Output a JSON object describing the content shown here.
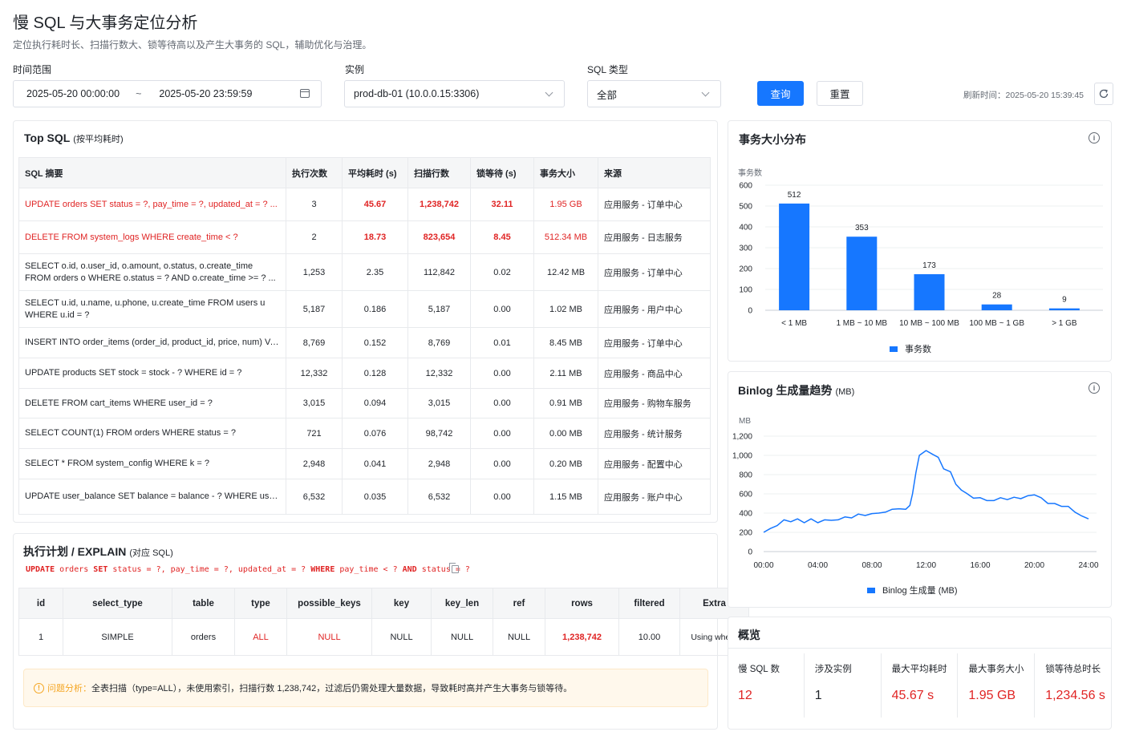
{
  "page": {
    "title": "慢 SQL 与大事务定位分析",
    "subtitle": "定位执行耗时长、扫描行数大、锁等待高以及产生大事务的 SQL，辅助优化与治理。"
  },
  "filters": {
    "time_label": "时间范围",
    "start": "2025-05-20 00:00:00",
    "sep": "~",
    "end": "2025-05-20 23:59:59",
    "instance_label": "实例",
    "instance_value": "prod-db-01 (10.0.0.15:3306)",
    "sqltype_label": "SQL 类型",
    "sqltype_value": "全部",
    "query_btn": "查询",
    "reset_btn": "重置",
    "refresh_text": "刷新时间：2025-05-20 15:39:45"
  },
  "top_sql": {
    "title": "Top SQL",
    "title_note": "(按平均耗时)",
    "columns": [
      "SQL 摘要",
      "执行次数",
      "平均耗时 (s)",
      "扫描行数",
      "锁等待 (s)",
      "事务大小",
      "来源"
    ],
    "rows": [
      {
        "sql": "UPDATE orders SET status = ?, pay_time = ?, updated_at = ? ...",
        "exec": "3",
        "avg": "45.67",
        "scan": "1,238,742",
        "lock": "32.11",
        "size": "1.95 GB",
        "src": "应用服务 - 订单中心",
        "hl": true
      },
      {
        "sql": "DELETE FROM system_logs WHERE create_time < ?",
        "exec": "2",
        "avg": "18.73",
        "scan": "823,654",
        "lock": "8.45",
        "size": "512.34 MB",
        "src": "应用服务 - 日志服务",
        "hl": true
      },
      {
        "sql": "SELECT o.id, o.user_id, o.amount, o.status, o.create_time FROM orders o WHERE o.status = ? AND o.create_time >= ? ...",
        "exec": "1,253",
        "avg": "2.35",
        "scan": "112,842",
        "lock": "0.02",
        "size": "12.42 MB",
        "src": "应用服务 - 订单中心",
        "hl": false
      },
      {
        "sql": "SELECT u.id, u.name, u.phone, u.create_time FROM users u WHERE u.id = ?",
        "exec": "5,187",
        "avg": "0.186",
        "scan": "5,187",
        "lock": "0.00",
        "size": "1.02 MB",
        "src": "应用服务 - 用户中心",
        "hl": false
      },
      {
        "sql": "INSERT INTO order_items (order_id, product_id, price, num) VALUES ...",
        "exec": "8,769",
        "avg": "0.152",
        "scan": "8,769",
        "lock": "0.01",
        "size": "8.45 MB",
        "src": "应用服务 - 订单中心",
        "hl": false
      },
      {
        "sql": "UPDATE products SET stock = stock - ? WHERE id = ?",
        "exec": "12,332",
        "avg": "0.128",
        "scan": "12,332",
        "lock": "0.00",
        "size": "2.11 MB",
        "src": "应用服务 - 商品中心",
        "hl": false
      },
      {
        "sql": "DELETE FROM cart_items WHERE user_id = ?",
        "exec": "3,015",
        "avg": "0.094",
        "scan": "3,015",
        "lock": "0.00",
        "size": "0.91 MB",
        "src": "应用服务 - 购物车服务",
        "hl": false
      },
      {
        "sql": "SELECT COUNT(1) FROM orders WHERE status = ?",
        "exec": "721",
        "avg": "0.076",
        "scan": "98,742",
        "lock": "0.00",
        "size": "0.00 MB",
        "src": "应用服务 - 统计服务",
        "hl": false
      },
      {
        "sql": "SELECT * FROM system_config WHERE k = ?",
        "exec": "2,948",
        "avg": "0.041",
        "scan": "2,948",
        "lock": "0.00",
        "size": "0.20 MB",
        "src": "应用服务 - 配置中心",
        "hl": false
      },
      {
        "sql": "UPDATE user_balance SET balance = balance - ? WHERE user_id = ?",
        "exec": "6,532",
        "avg": "0.035",
        "scan": "6,532",
        "lock": "0.00",
        "size": "1.15 MB",
        "src": "应用服务 - 账户中心",
        "hl": false
      }
    ]
  },
  "explain": {
    "title": "执行计划 / EXPLAIN",
    "title_note": "(对应 SQL)",
    "sql_parts": [
      {
        "t": "UPDATE",
        "kw": true
      },
      {
        "t": " orders ",
        "kw": false
      },
      {
        "t": "SET",
        "kw": true
      },
      {
        "t": " status = ?, pay_time = ?, updated_at = ? ",
        "kw": false
      },
      {
        "t": "WHERE",
        "kw": true
      },
      {
        "t": " pay_time < ? ",
        "kw": false
      },
      {
        "t": "AND",
        "kw": true
      },
      {
        "t": " status = ?",
        "kw": false
      }
    ],
    "columns": [
      "id",
      "select_type",
      "table",
      "type",
      "possible_keys",
      "key",
      "key_len",
      "ref",
      "rows",
      "filtered",
      "Extra"
    ],
    "row": [
      "1",
      "SIMPLE",
      "orders",
      "ALL",
      "NULL",
      "NULL",
      "NULL",
      "NULL",
      "1,238,742",
      "10.00",
      "Using where"
    ],
    "analysis_label": "问题分析：",
    "analysis_text": "全表扫描（type=ALL），未使用索引，扫描行数 1,238,742，过滤后仍需处理大量数据，导致耗时高并产生大事务与锁等待。"
  },
  "tx_chart": {
    "title": "事务大小分布",
    "ylabel": "事务数",
    "legend": "事务数",
    "color": "#1677ff",
    "chart_data": {
      "type": "bar",
      "categories": [
        "< 1 MB",
        "1 MB ~ 10 MB",
        "10 MB ~ 100 MB",
        "100 MB ~ 1 GB",
        "> 1 GB"
      ],
      "values": [
        512,
        353,
        173,
        28,
        9
      ],
      "ylabel": "事务数",
      "ylim": [
        0,
        600
      ],
      "yticks": [
        "0",
        "100",
        "200",
        "300",
        "400",
        "500",
        "600"
      ]
    }
  },
  "binlog_chart": {
    "title": "Binlog 生成量趋势",
    "title_note": "(MB)",
    "ylabel": "MB",
    "legend": "Binlog 生成量 (MB)",
    "color": "#1677ff",
    "chart_data": {
      "type": "line",
      "xticks": [
        "00:00",
        "04:00",
        "08:00",
        "12:00",
        "16:00",
        "20:00",
        "24:00"
      ],
      "yticks": [
        "0",
        "200",
        "400",
        "600",
        "800",
        "1,000",
        "1,200"
      ],
      "ylim": [
        0,
        1200
      ],
      "xlim": [
        0,
        24
      ],
      "x": [
        0,
        0.5,
        1,
        1.5,
        2,
        2.5,
        3,
        3.5,
        4,
        4.5,
        5,
        5.5,
        6,
        6.5,
        7,
        7.5,
        8,
        8.5,
        9,
        9.5,
        10,
        10.5,
        10.8,
        11,
        11.25,
        11.5,
        12,
        12.5,
        12.9,
        13.3,
        13.8,
        14.2,
        14.6,
        15,
        15.5,
        16,
        16.5,
        17,
        17.5,
        18,
        18.5,
        19,
        19.5,
        20,
        20.5,
        21,
        21.5,
        22,
        22.5,
        23,
        23.5,
        24
      ],
      "y": [
        200,
        240,
        270,
        330,
        310,
        340,
        300,
        340,
        300,
        330,
        325,
        330,
        360,
        350,
        390,
        375,
        395,
        400,
        410,
        440,
        445,
        440,
        480,
        600,
        820,
        1000,
        1050,
        1010,
        980,
        860,
        830,
        700,
        640,
        605,
        555,
        560,
        530,
        530,
        560,
        540,
        565,
        550,
        580,
        590,
        560,
        500,
        500,
        470,
        470,
        410,
        370,
        340
      ]
    }
  },
  "overview": {
    "title": "概览",
    "items": [
      {
        "label": "慢 SQL 数",
        "value": "12",
        "red": true
      },
      {
        "label": "涉及实例",
        "value": "1",
        "red": false
      },
      {
        "label": "最大平均耗时",
        "value": "45.67 s",
        "red": true
      },
      {
        "label": "最大事务大小",
        "value": "1.95 GB",
        "red": true
      },
      {
        "label": "锁等待总时长",
        "value": "1,234.56 s",
        "red": true
      }
    ]
  }
}
